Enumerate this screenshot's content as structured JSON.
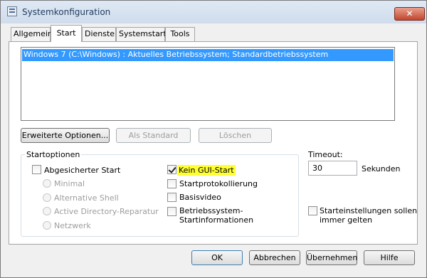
{
  "window": {
    "title": "Systemkonfiguration",
    "close_glyph": "✕"
  },
  "tabs": [
    "Allgemein",
    "Start",
    "Dienste",
    "Systemstart",
    "Tools"
  ],
  "active_tab": "Start",
  "boot_list": {
    "items": [
      "Windows 7 (C:\\Windows) : Aktuelles Betriebssystem; Standardbetriebssystem"
    ],
    "selected_index": 0
  },
  "list_buttons": {
    "advanced": "Erweiterte Optionen...",
    "set_default": "Als Standard",
    "delete": "Löschen"
  },
  "boot_options": {
    "label": "Startoptionen",
    "safe_boot": {
      "label": "Abgesicherter Start",
      "checked": false
    },
    "safe_modes": [
      "Minimal",
      "Alternative Shell",
      "Active Directory-Reparatur",
      "Netzwerk"
    ],
    "no_gui_boot": {
      "label": "Kein GUI-Start",
      "checked": true
    },
    "boot_log": {
      "label": "Startprotokollierung",
      "checked": false
    },
    "base_video": {
      "label": "Basisvideo",
      "checked": false
    },
    "os_boot_info": {
      "label_line1": "Betriebssystem-",
      "label_line2": "Startinformationen",
      "checked": false
    }
  },
  "timeout": {
    "label": "Timeout:",
    "value": "30",
    "unit": "Sekunden"
  },
  "make_permanent": {
    "label_line1": "Starteinstellungen sollen",
    "label_line2": "immer gelten",
    "checked": false
  },
  "dialog_buttons": {
    "ok": "OK",
    "cancel": "Abbrechen",
    "apply": "Übernehmen",
    "help": "Hilfe"
  },
  "colors": {
    "selection": "#3399ff",
    "highlight": "#ffff33",
    "title_text": "#1e395b"
  }
}
